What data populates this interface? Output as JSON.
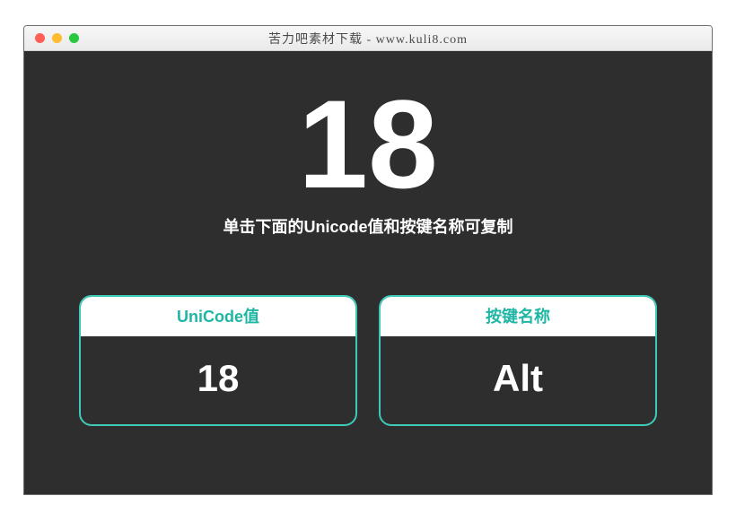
{
  "window": {
    "title": "苦力吧素材下载 - www.kuli8.com"
  },
  "main": {
    "big_value": "18",
    "instruction": "单击下面的Unicode值和按键名称可复制"
  },
  "cards": {
    "unicode": {
      "header": "UniCode值",
      "value": "18"
    },
    "keyname": {
      "header": "按键名称",
      "value": "Alt"
    }
  },
  "colors": {
    "accent": "#3ec9b8",
    "bg_dark": "#2e2e2e"
  }
}
